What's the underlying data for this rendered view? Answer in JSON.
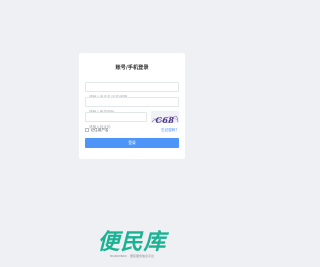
{
  "login": {
    "title": "账号/手机登录",
    "username_placeholder": "请输入用户名/手机/邮箱",
    "password_placeholder": "请输入登录密码",
    "captcha_placeholder": "请输入验证码",
    "captcha_code": "C68",
    "remember_label": "记住用户名",
    "forgot_label": "忘记密码？",
    "login_button": "登录"
  },
  "footer": {
    "logo_text": "便民库",
    "logo_subtitle": "BIANMINKU · 便民服务信息平台"
  },
  "colors": {
    "accent": "#4d96f7",
    "link": "#3b82f6",
    "logo": "#19b394",
    "background": "#eef0f3"
  }
}
